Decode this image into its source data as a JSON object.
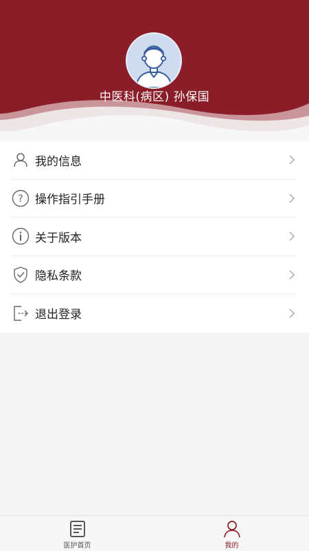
{
  "colors": {
    "brand": "#8a1d27",
    "brand_light": "#a7333d",
    "background": "#f4f4f5"
  },
  "profile": {
    "avatar_icon": "user-avatar-icon",
    "name": "中医科(病区) 孙保国"
  },
  "menu": {
    "items": [
      {
        "label": "我的信息",
        "icon": "user-icon"
      },
      {
        "label": "操作指引手册",
        "icon": "question-circle-icon"
      },
      {
        "label": "关于版本",
        "icon": "info-circle-icon"
      },
      {
        "label": "隐私条款",
        "icon": "shield-check-icon"
      },
      {
        "label": "退出登录",
        "icon": "logout-icon"
      }
    ],
    "chevron_icon": "chevron-right-icon"
  },
  "tabbar": {
    "items": [
      {
        "label": "医护首页",
        "icon": "document-icon",
        "active": false
      },
      {
        "label": "我的",
        "icon": "user-icon",
        "active": true
      }
    ]
  }
}
